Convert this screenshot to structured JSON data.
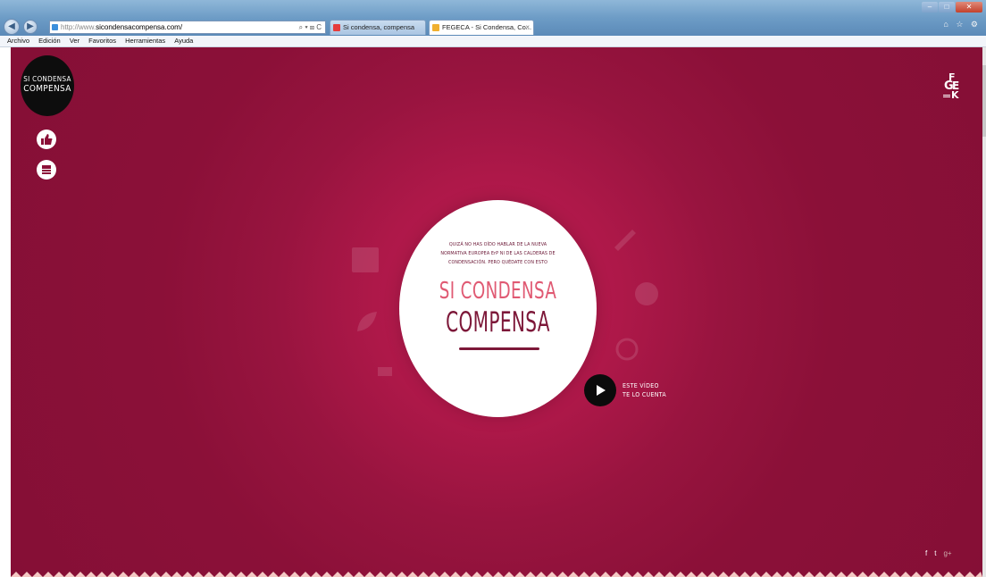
{
  "browser": {
    "address_protocol": "http://www.",
    "address_host": "sicondensacompensa.com/",
    "address_tools": "⌕ ▾ ⊠ C",
    "tabs": [
      {
        "label": "Si condensa, compensa",
        "active": false,
        "icon_color": "#e63c3c"
      },
      {
        "label": "FEGECA - Si Condensa, Co...",
        "active": true,
        "icon_color": "#f0b030",
        "close": "×"
      }
    ],
    "window_controls": {
      "minimize": "–",
      "maximize": "□",
      "close": "✕"
    },
    "chrome_icons": "⌂ ☆ ⚙"
  },
  "menubar": {
    "items": [
      "Archivo",
      "Edición",
      "Ver",
      "Favoritos",
      "Herramientas",
      "Ayuda"
    ]
  },
  "page": {
    "logo": {
      "line1": "SI CONDENSA",
      "line2": "COMPENSA"
    },
    "side_buttons": [
      {
        "icon": "thumbs-up-icon"
      },
      {
        "icon": "document-icon"
      }
    ],
    "brand_logo": "fegeca-logo",
    "hero": {
      "intro_lines": [
        "QUIZÁ NO HAS OÍDO HABLAR DE LA NUEVA",
        "NORMATIVA EUROPEA ErP NI DE LAS CALDERAS DE",
        "CONDENSACIÓN. PERO QUÉDATE CON ESTO"
      ],
      "title_line1": "SI CONDENSA",
      "title_line2": "COMPENSA"
    },
    "video": {
      "line1": "ESTE VÍDEO",
      "line2": "TE LO CUENTA"
    },
    "social": {
      "facebook": "f",
      "twitter": "t",
      "googleplus": "g+"
    },
    "colors": {
      "background": "#8b1038",
      "hero_title_light": "#e05a73",
      "hero_title_dark": "#7d1839",
      "disc": "#ffffff"
    }
  }
}
